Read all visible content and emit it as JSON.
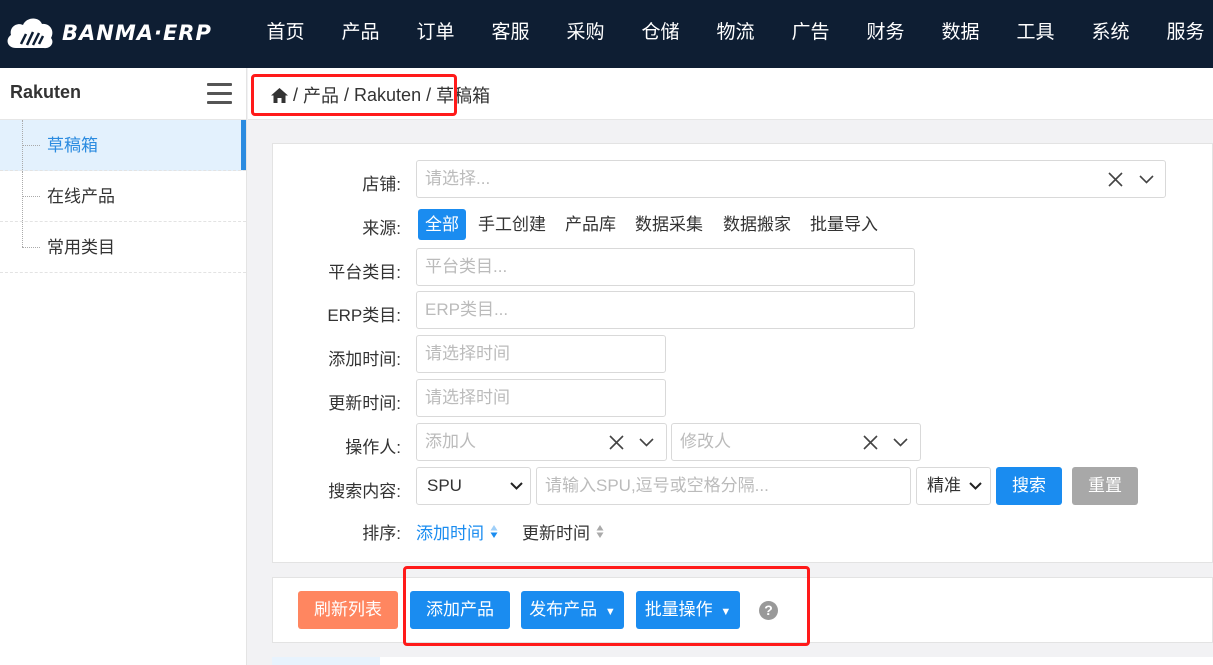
{
  "brand": {
    "name": "BANMA·ERP"
  },
  "nav": [
    {
      "label": "首页"
    },
    {
      "label": "产品"
    },
    {
      "label": "订单"
    },
    {
      "label": "客服"
    },
    {
      "label": "采购"
    },
    {
      "label": "仓储"
    },
    {
      "label": "物流"
    },
    {
      "label": "广告"
    },
    {
      "label": "财务"
    },
    {
      "label": "数据"
    },
    {
      "label": "工具"
    },
    {
      "label": "系统"
    },
    {
      "label": "服务"
    }
  ],
  "sidebar": {
    "title": "Rakuten",
    "items": [
      {
        "label": "草稿箱",
        "active": true
      },
      {
        "label": "在线产品"
      },
      {
        "label": "常用类目"
      }
    ]
  },
  "breadcrumb": {
    "home_icon": "home-icon",
    "items": [
      "产品",
      "Rakuten",
      "草稿箱"
    ],
    "separator": "/"
  },
  "filters": {
    "shop": {
      "label": "店铺:",
      "placeholder": "请选择..."
    },
    "source": {
      "label": "来源:",
      "options": [
        "全部",
        "手工创建",
        "产品库",
        "数据采集",
        "数据搬家",
        "批量导入"
      ],
      "selected": "全部"
    },
    "platform_category": {
      "label": "平台类目:",
      "placeholder": "平台类目..."
    },
    "erp_category": {
      "label": "ERP类目:",
      "placeholder": "ERP类目..."
    },
    "added_time": {
      "label": "添加时间:",
      "placeholder": "请选择时间"
    },
    "updated_time": {
      "label": "更新时间:",
      "placeholder": "请选择时间"
    },
    "operator": {
      "label": "操作人:",
      "adder_placeholder": "添加人",
      "modifier_placeholder": "修改人"
    },
    "search": {
      "label": "搜索内容:",
      "field": "SPU",
      "placeholder": "请输入SPU,逗号或空格分隔...",
      "mode": "精准",
      "search_label": "搜索",
      "reset_label": "重置"
    },
    "sort": {
      "label": "排序:",
      "options": [
        "添加时间",
        "更新时间"
      ],
      "active": "添加时间"
    }
  },
  "actions": {
    "refresh_label": "刷新列表",
    "add_label": "添加产品",
    "publish_label": "发布产品",
    "batch_label": "批量操作",
    "help_glyph": "?"
  },
  "colors": {
    "nav_bg": "#0e1e33",
    "primary": "#1a8cf0",
    "refresh": "#ff8660",
    "reset": "#a8a8a8",
    "highlight": "#ff1a1a"
  }
}
